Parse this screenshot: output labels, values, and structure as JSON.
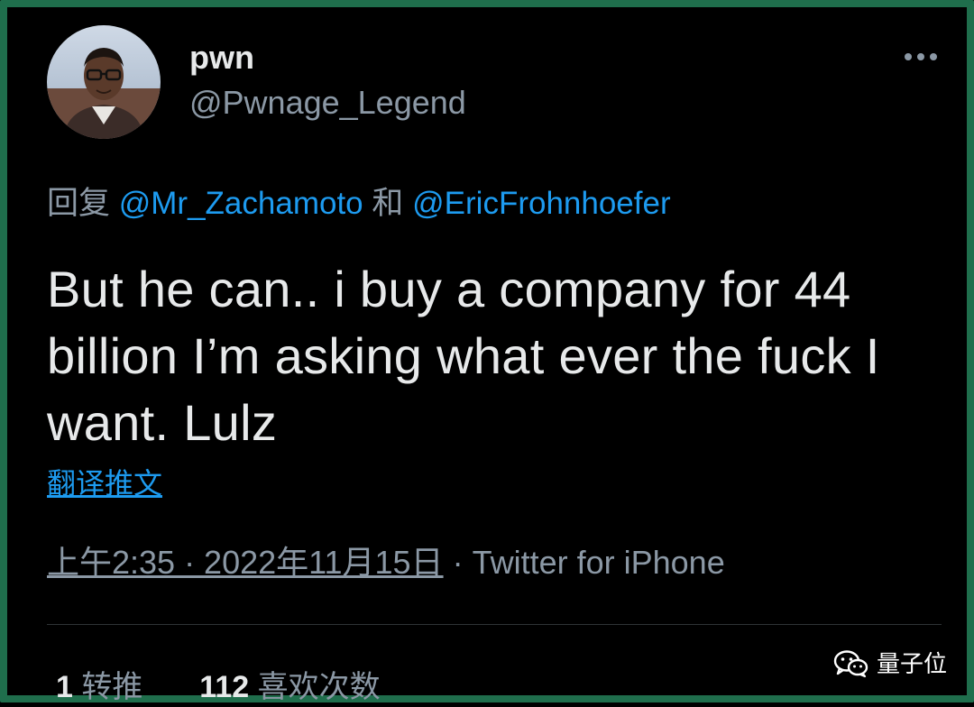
{
  "author": {
    "display_name": "pwn",
    "handle": "@Pwnage_Legend",
    "avatar": "user-avatar-photo"
  },
  "more_icon": "ellipsis-icon",
  "reply": {
    "prefix": "回复",
    "mention_1": "@Mr_Zachamoto",
    "joiner": "和",
    "mention_2": "@EricFrohnhoefer"
  },
  "tweet": {
    "text": "But he can.. i buy a company for 44 billion I’m asking what ever the fuck I want. Lulz"
  },
  "translate_label": "翻译推文",
  "meta": {
    "timestamp": "上午2:35 · 2022年11月15日",
    "separator": "·",
    "source": "Twitter for iPhone"
  },
  "stats": {
    "retweets_count": "1",
    "retweets_label": "转推",
    "likes_count": "112",
    "likes_label": "喜欢次数"
  },
  "watermark": {
    "icon": "wechat-icon",
    "label": "量子位"
  },
  "colors": {
    "background": "#000000",
    "frame": "#1f6e4c",
    "text_primary": "#e7e9ea",
    "text_secondary": "#8b98a5",
    "link": "#1d9bf0",
    "divider": "#2f3336"
  }
}
